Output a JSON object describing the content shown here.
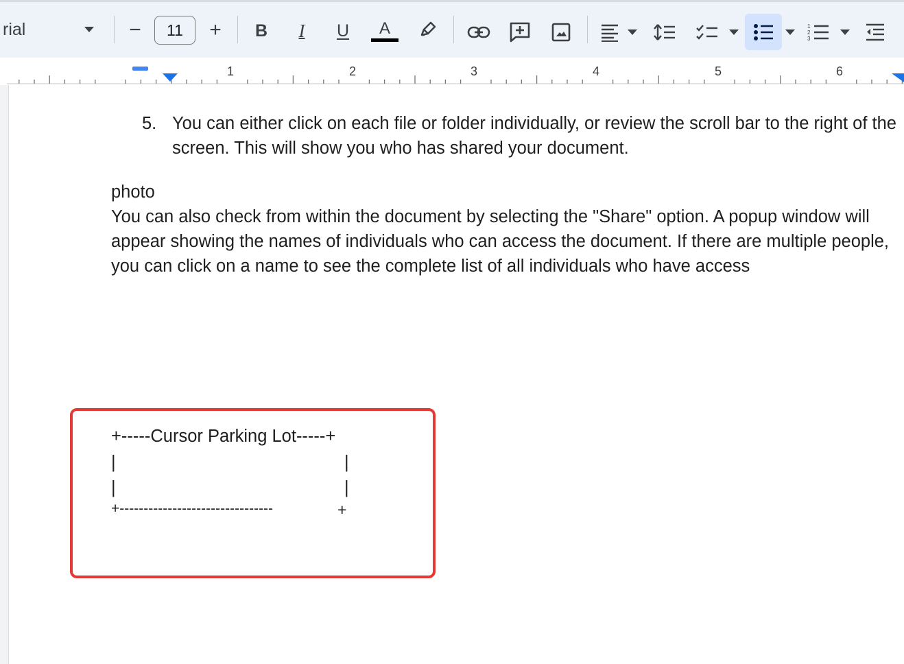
{
  "toolbar": {
    "font_name": "rial",
    "font_size": "11",
    "decrease_label": "−",
    "increase_label": "+",
    "bold_label": "B",
    "italic_label": "I",
    "underline_label": "U",
    "text_color_label": "A",
    "accent_color": "#1a73e8",
    "active_bg": "#d3e3fd",
    "icons": [
      "pencil-icon",
      "link-icon",
      "add-comment-icon",
      "insert-image-icon",
      "align-icon",
      "line-spacing-icon",
      "checklist-icon",
      "bulleted-list-icon",
      "numbered-list-icon",
      "decrease-indent-icon"
    ]
  },
  "ruler": {
    "numbers": [
      "1",
      "2",
      "3",
      "4",
      "5",
      "6"
    ]
  },
  "document": {
    "list_number": "5.",
    "list_text": "You can either click on each file or folder individually, or review the scroll bar to the right of the screen. This will show you who has shared your document.",
    "photo_label": "photo",
    "paragraph": "You can also check from within the document by selecting the \"Share\" option. A popup window will appear showing the names of individuals who can access the document. If there are multiple people, you can click on a name to see the complete list of all individuals who have access",
    "parking_top": "+-----Cursor Parking Lot-----+",
    "parking_pipe": "|",
    "parking_bottom_left": "+--------------------------------",
    "parking_bottom_right": "+"
  },
  "highlight_color": "#e53935"
}
